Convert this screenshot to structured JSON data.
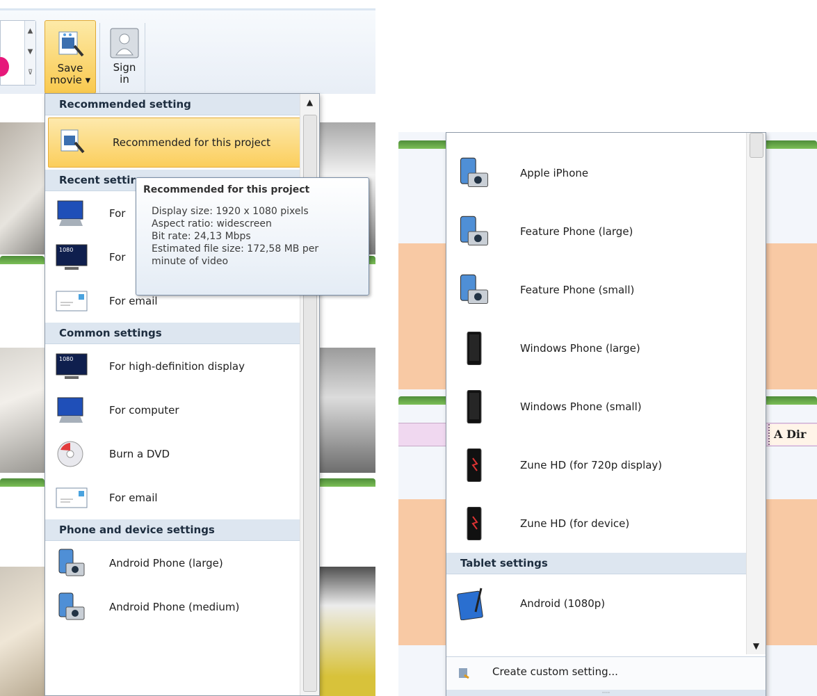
{
  "ribbon": {
    "save_movie": [
      "Save",
      "movie ▾"
    ],
    "sign_in": [
      "Sign",
      "in"
    ]
  },
  "left_menu": {
    "sections": [
      {
        "header": "Recommended setting",
        "items": [
          {
            "label": "Recommended for this project",
            "icon": "save-movie-icon",
            "highlighted": true
          }
        ]
      },
      {
        "header": "Recent settings",
        "header_visible": "Recent settir",
        "items": [
          {
            "label": "For ",
            "icon": "computer-icon"
          },
          {
            "label": "For ",
            "icon": "hd-display-icon"
          },
          {
            "label": "For email",
            "icon": "email-icon"
          }
        ]
      },
      {
        "header": "Common settings",
        "items": [
          {
            "label": "For high-definition display",
            "icon": "hd-display-icon"
          },
          {
            "label": "For computer",
            "icon": "computer-icon"
          },
          {
            "label": "Burn a DVD",
            "icon": "dvd-icon"
          },
          {
            "label": "For email",
            "icon": "email-icon"
          }
        ]
      },
      {
        "header": "Phone and device settings",
        "items": [
          {
            "label": "Android Phone (large)",
            "icon": "phone-camera-icon"
          },
          {
            "label": "Android Phone (medium)",
            "icon": "phone-camera-icon"
          }
        ]
      }
    ]
  },
  "tooltip": {
    "title": "Recommended for this project",
    "lines": [
      "Display size: 1920 x 1080 pixels",
      "Aspect ratio: widescreen",
      "Bit rate: 24,13 Mbps",
      "Estimated file size: 172,58 MB per",
      "minute of video"
    ]
  },
  "right_menu": {
    "items": [
      {
        "label": "Apple iPhone",
        "icon": "phone-camera-icon"
      },
      {
        "label": "Feature Phone (large)",
        "icon": "phone-camera-icon"
      },
      {
        "label": "Feature Phone (small)",
        "icon": "phone-camera-icon"
      },
      {
        "label": "Windows Phone (large)",
        "icon": "smartphone-icon"
      },
      {
        "label": "Windows Phone (small)",
        "icon": "smartphone-icon"
      },
      {
        "label": "Zune HD (for 720p display)",
        "icon": "zune-icon"
      },
      {
        "label": "Zune HD (for device)",
        "icon": "zune-icon"
      }
    ],
    "tablet_header": "Tablet settings",
    "tablet_items": [
      {
        "label": "Android (1080p)",
        "icon": "tablet-icon"
      }
    ],
    "footer_label": "Create custom setting...",
    "timeline_caption": "A Dir"
  },
  "colors": {
    "highlight": "#fbce5c",
    "header_bg": "#dde6f0",
    "timeline_peach": "#f8c9a4",
    "caption_purple": "#f0d8f0"
  }
}
